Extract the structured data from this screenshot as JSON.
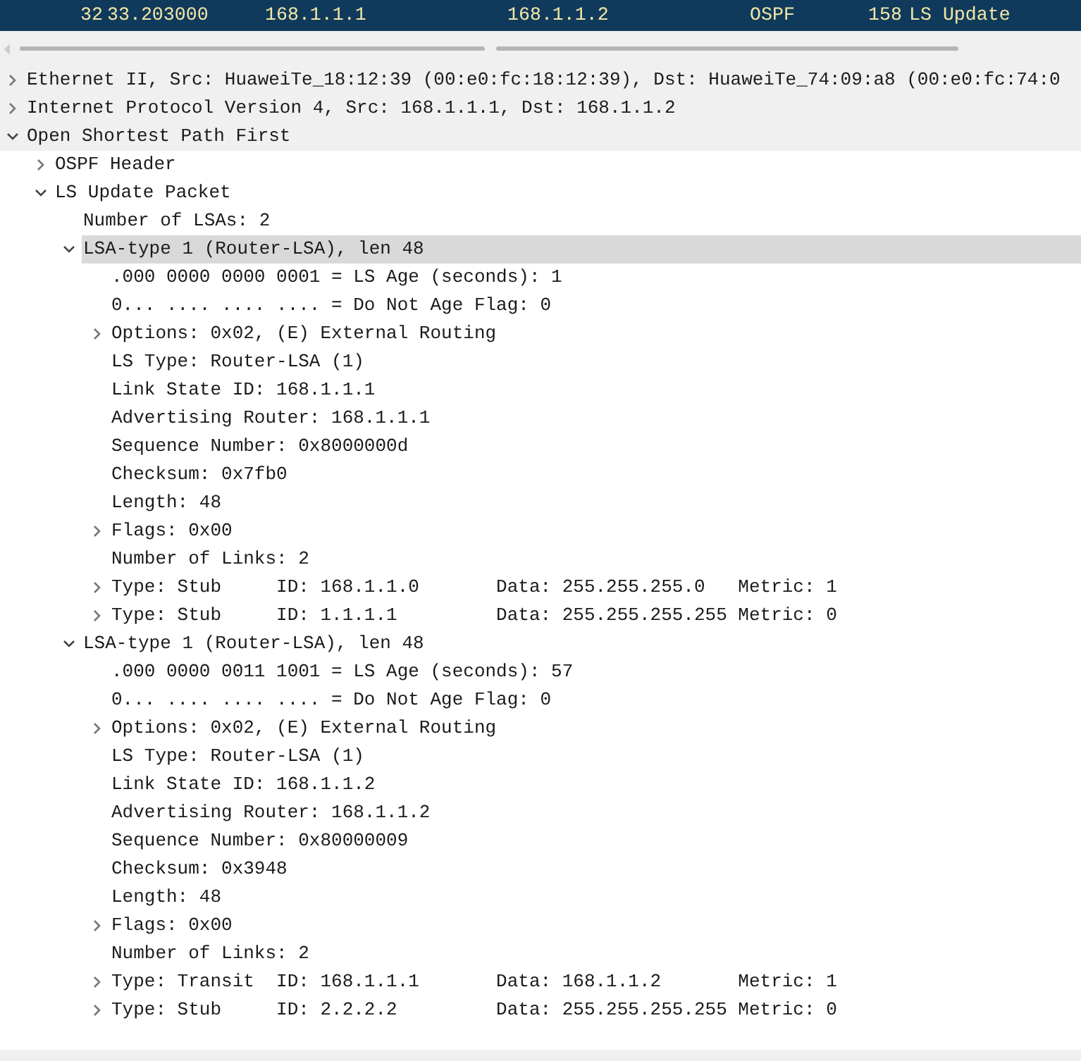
{
  "packet_row": {
    "number": "32",
    "time": "33.203000",
    "source": "168.1.1.1",
    "destination": "168.1.1.2",
    "protocol": "OSPF",
    "length": "158",
    "info": "LS Update",
    "selected": true
  },
  "tree": [
    {
      "text": "Ethernet II, Src: HuaweiTe_18:12:39 (00:e0:fc:18:12:39), Dst: HuaweiTe_74:09:a8 (00:e0:fc:74:0",
      "expanded": false,
      "selected": false
    },
    {
      "text": "Internet Protocol Version 4, Src: 168.1.1.1, Dst: 168.1.1.2",
      "expanded": false,
      "selected": false
    },
    {
      "text": "Open Shortest Path First",
      "expanded": true,
      "selected": false,
      "children": [
        {
          "text": "OSPF Header",
          "expanded": false,
          "selected": false
        },
        {
          "text": "LS Update Packet",
          "expanded": true,
          "selected": false,
          "children": [
            {
              "text": "Number of LSAs: 2",
              "selected": false
            },
            {
              "text": "LSA-type 1 (Router-LSA), len 48",
              "expanded": true,
              "selected": true,
              "children": [
                {
                  "text": ".000 0000 0000 0001 = LS Age (seconds): 1",
                  "selected": false
                },
                {
                  "text": "0... .... .... .... = Do Not Age Flag: 0",
                  "selected": false
                },
                {
                  "text": "Options: 0x02, (E) External Routing",
                  "expanded": false,
                  "selected": false
                },
                {
                  "text": "LS Type: Router-LSA (1)",
                  "selected": false
                },
                {
                  "text": "Link State ID: 168.1.1.1",
                  "selected": false
                },
                {
                  "text": "Advertising Router: 168.1.1.1",
                  "selected": false
                },
                {
                  "text": "Sequence Number: 0x8000000d",
                  "selected": false
                },
                {
                  "text": "Checksum: 0x7fb0",
                  "selected": false
                },
                {
                  "text": "Length: 48",
                  "selected": false
                },
                {
                  "text": "Flags: 0x00",
                  "expanded": false,
                  "selected": false
                },
                {
                  "text": "Number of Links: 2",
                  "selected": false
                },
                {
                  "text": "Type: Stub     ID: 168.1.1.0       Data: 255.255.255.0   Metric: 1",
                  "expanded": false,
                  "selected": false
                },
                {
                  "text": "Type: Stub     ID: 1.1.1.1         Data: 255.255.255.255 Metric: 0",
                  "expanded": false,
                  "selected": false
                }
              ]
            },
            {
              "text": "LSA-type 1 (Router-LSA), len 48",
              "expanded": true,
              "selected": false,
              "children": [
                {
                  "text": ".000 0000 0011 1001 = LS Age (seconds): 57",
                  "selected": false
                },
                {
                  "text": "0... .... .... .... = Do Not Age Flag: 0",
                  "selected": false
                },
                {
                  "text": "Options: 0x02, (E) External Routing",
                  "expanded": false,
                  "selected": false
                },
                {
                  "text": "LS Type: Router-LSA (1)",
                  "selected": false
                },
                {
                  "text": "Link State ID: 168.1.1.2",
                  "selected": false
                },
                {
                  "text": "Advertising Router: 168.1.1.2",
                  "selected": false
                },
                {
                  "text": "Sequence Number: 0x80000009",
                  "selected": false
                },
                {
                  "text": "Checksum: 0x3948",
                  "selected": false
                },
                {
                  "text": "Length: 48",
                  "selected": false
                },
                {
                  "text": "Flags: 0x00",
                  "expanded": false,
                  "selected": false
                },
                {
                  "text": "Number of Links: 2",
                  "selected": false
                },
                {
                  "text": "Type: Transit  ID: 168.1.1.1       Data: 168.1.1.2       Metric: 1",
                  "expanded": false,
                  "selected": false
                },
                {
                  "text": "Type: Stub     ID: 2.2.2.2         Data: 255.255.255.255 Metric: 0",
                  "expanded": false,
                  "selected": false
                }
              ]
            }
          ]
        }
      ]
    }
  ]
}
